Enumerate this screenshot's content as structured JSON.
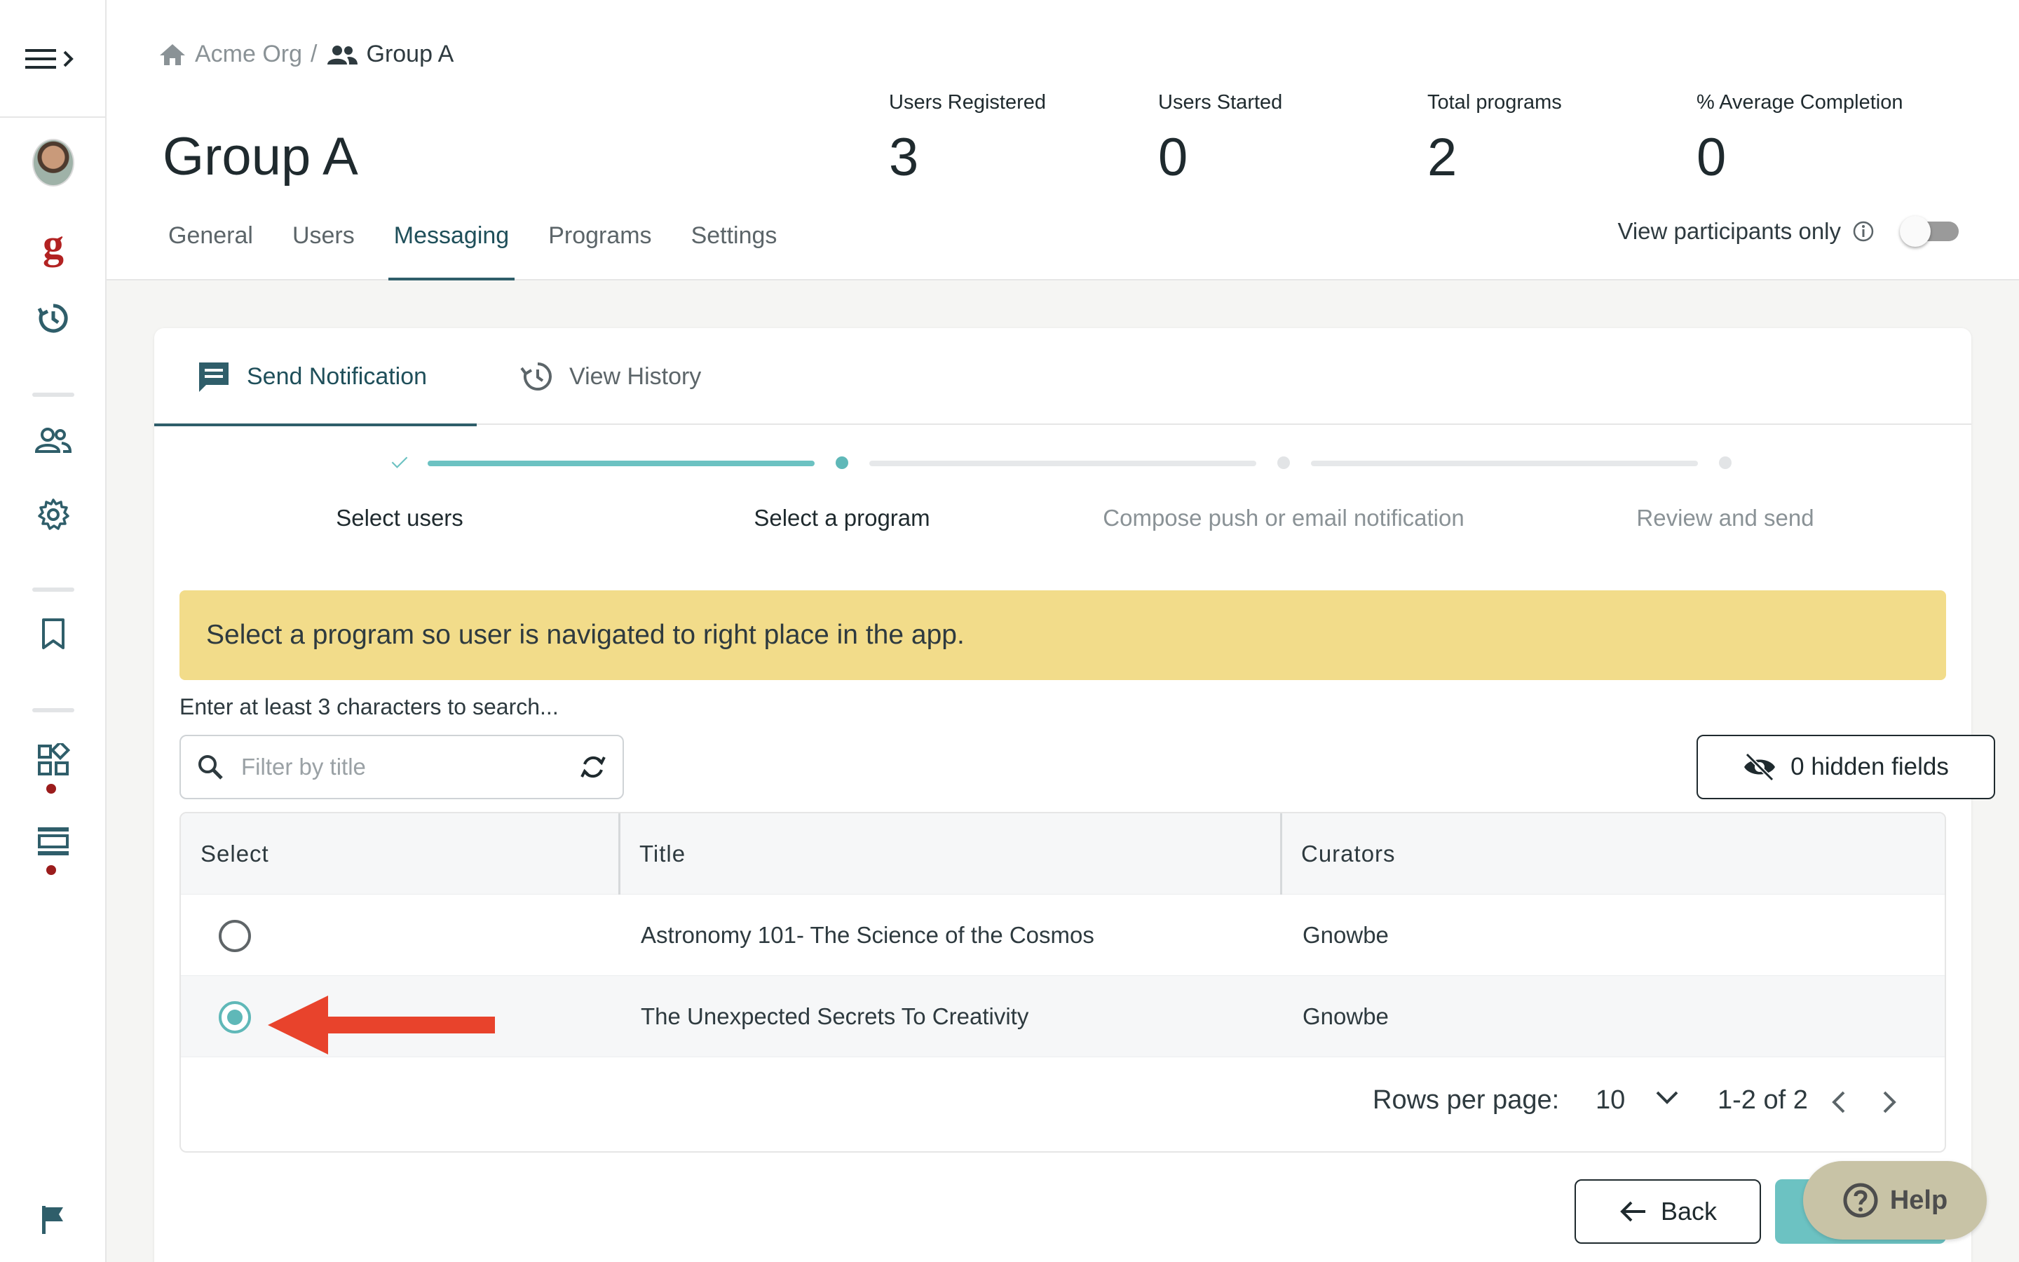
{
  "breadcrumb": {
    "org": "Acme Org",
    "separator": "/",
    "group": "Group A"
  },
  "page_title": "Group A",
  "stats": [
    {
      "label": "Users Registered",
      "value": "3"
    },
    {
      "label": "Users Started",
      "value": "0"
    },
    {
      "label": "Total programs",
      "value": "2"
    },
    {
      "label": "% Average Completion",
      "value": "0"
    }
  ],
  "tabs": [
    "General",
    "Users",
    "Messaging",
    "Programs",
    "Settings"
  ],
  "active_tab": "Messaging",
  "participants_toggle": {
    "label": "View participants only",
    "on": false
  },
  "card_tabs": {
    "send": "Send Notification",
    "history": "View History"
  },
  "stepper": {
    "steps": [
      "Select users",
      "Select a program",
      "Compose push or email notification",
      "Review and send"
    ],
    "current_step": 2
  },
  "banner": "Select a program so user is navigated to right place in the app.",
  "search": {
    "hint": "Enter at least 3 characters to search...",
    "placeholder": "Filter by title",
    "value": ""
  },
  "hidden_fields_label": "0 hidden fields",
  "table": {
    "columns": [
      "Select",
      "Title",
      "Curators"
    ],
    "rows": [
      {
        "title": "Astronomy 101- The Science of the Cosmos",
        "curators": "Gnowbe",
        "selected": false
      },
      {
        "title": "The Unexpected Secrets To Creativity",
        "curators": "Gnowbe",
        "selected": true
      }
    ]
  },
  "pagination": {
    "rows_per_page_label": "Rows per page:",
    "rows_per_page": "10",
    "range": "1-2 of 2"
  },
  "buttons": {
    "back": "Back",
    "help": "Help"
  },
  "colors": {
    "accent": "#6cc2c2",
    "primary_dark": "#2f5e6a",
    "banner": "#f2dc8a",
    "alert_arrow": "#e8432c",
    "brand_red": "#b22222"
  }
}
